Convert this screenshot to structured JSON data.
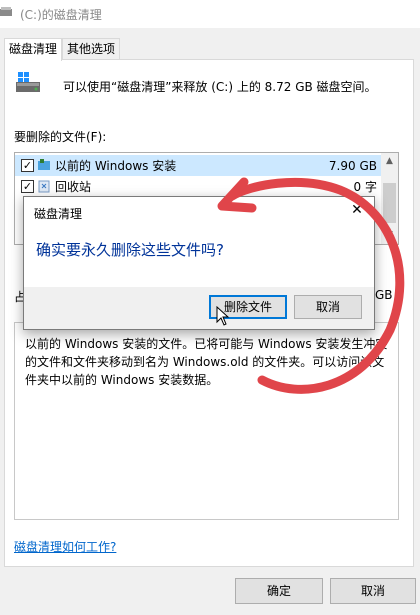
{
  "window": {
    "title": "(C:)的磁盘清理"
  },
  "tabs": [
    {
      "label": "磁盘清理",
      "active": true
    },
    {
      "label": "其他选项",
      "active": false
    }
  ],
  "main": {
    "drive_description": "可以使用“磁盘清理”来释放 (C:) 上的 8.72 GB 磁盘空间。",
    "files_label": "要删除的文件(F):",
    "files": [
      {
        "name": "以前的 Windows 安装",
        "size": "7.90 GB",
        "checked": true,
        "selected": true,
        "icon": "windows-icon"
      },
      {
        "name": "回收站",
        "size": "0 字",
        "checked": true,
        "selected": false,
        "icon": "recycle-bin-icon"
      }
    ],
    "total_label": "占",
    "total_value": "GB",
    "description": "以前的 Windows 安装的文件。已将可能与 Windows 安装发生冲突的文件和文件夹移动到名为 Windows.old 的文件夹。可以访问该文件夹中以前的 Windows 安装数据。",
    "help_link": "磁盘清理如何工作?"
  },
  "footer": {
    "ok_label": "确定",
    "cancel_label": "取消"
  },
  "dialog": {
    "title": "磁盘清理",
    "message": "确实要永久删除这些文件吗?",
    "confirm_label": "删除文件",
    "cancel_label": "取消"
  },
  "colors": {
    "link": "#0066cc",
    "dialog_message": "#003399",
    "annotation_arrow": "#e0454a",
    "selection": "#cce8ff"
  }
}
